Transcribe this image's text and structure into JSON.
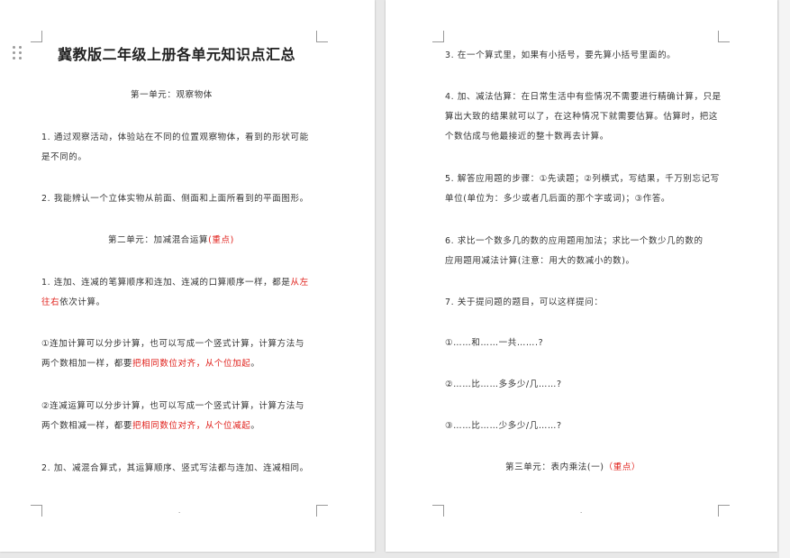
{
  "left_page": {
    "title": "冀教版二年级上册各单元知识点汇总",
    "unit1_heading": "第一单元：观察物体",
    "u1_p1_line1": "1. 通过观察活动，体验站在不同的位置观察物体，看到的形状可能",
    "u1_p1_line2": "是不同的。",
    "u1_p2": "2. 我能辨认一个立体实物从前面、侧面和上面所看到的平面图形。",
    "unit2_heading": "第二单元：加减混合运算",
    "unit2_tag": "(重点)",
    "u2_p1_line1_a": "1. 连加、连减的笔算顺序和连加、连减的口算顺序一样，都是",
    "u2_p1_line1_red": "从左",
    "u2_p1_line2_red": "往右",
    "u2_p1_line2_b": "依次计算。",
    "u2_p2_line1": "①连加计算可以分步计算，也可以写成一个竖式计算，计算方法与",
    "u2_p2_line2_a": "两个数相加一样，都要",
    "u2_p2_line2_red": "把相同数位对齐，从个位加起",
    "u2_p2_line2_b": "。",
    "u2_p3_line1": "②连减运算可以分步计算，也可以写成一个竖式计算，计算方法与",
    "u2_p3_line2_a": "两个数相减一样，都要",
    "u2_p3_line2_red": "把相同数位对齐，从个位减起",
    "u2_p3_line2_b": "。",
    "u2_p4": "2. 加、减混合算式，其运算顺序、竖式写法都与连加、连减相同。",
    "page_mark": "·"
  },
  "right_page": {
    "p3": "3. 在一个算式里，如果有小括号，要先算小括号里面的。",
    "p4_line1": "4. 加、减法估算：在日常生活中有些情况不需要进行精确计算，只是",
    "p4_line2": "算出大致的结果就可以了，在这种情况下就需要估算。估算时，把这",
    "p4_line3": "个数估成与他最接近的整十数再去计算。",
    "p5_line1": "5. 解答应用题的步骤：①先读题；②列横式，写结果，千万别忘记写",
    "p5_line2": "单位(单位为：多少或者几后面的那个字或词)；③作答。",
    "p6_line1": "6. 求比一个数多几的数的应用题用加法；求比一个数少几的数的",
    "p6_line2": "应用题用减法计算(注意：用大的数减小的数)。",
    "p7": "7. 关于提问题的题目，可以这样提问：",
    "q1": "①……和……一共…….?",
    "q2": "②……比……多多少/几……?",
    "q3": "③……比……少多少/几……?",
    "unit3_heading": "第三单元：表内乘法(一)",
    "unit3_tag": "（重点）",
    "page_mark": "·"
  },
  "colors": {
    "highlight": "#e0201b",
    "text": "#333333",
    "page": "#ffffff",
    "background": "#e8e8e8"
  }
}
